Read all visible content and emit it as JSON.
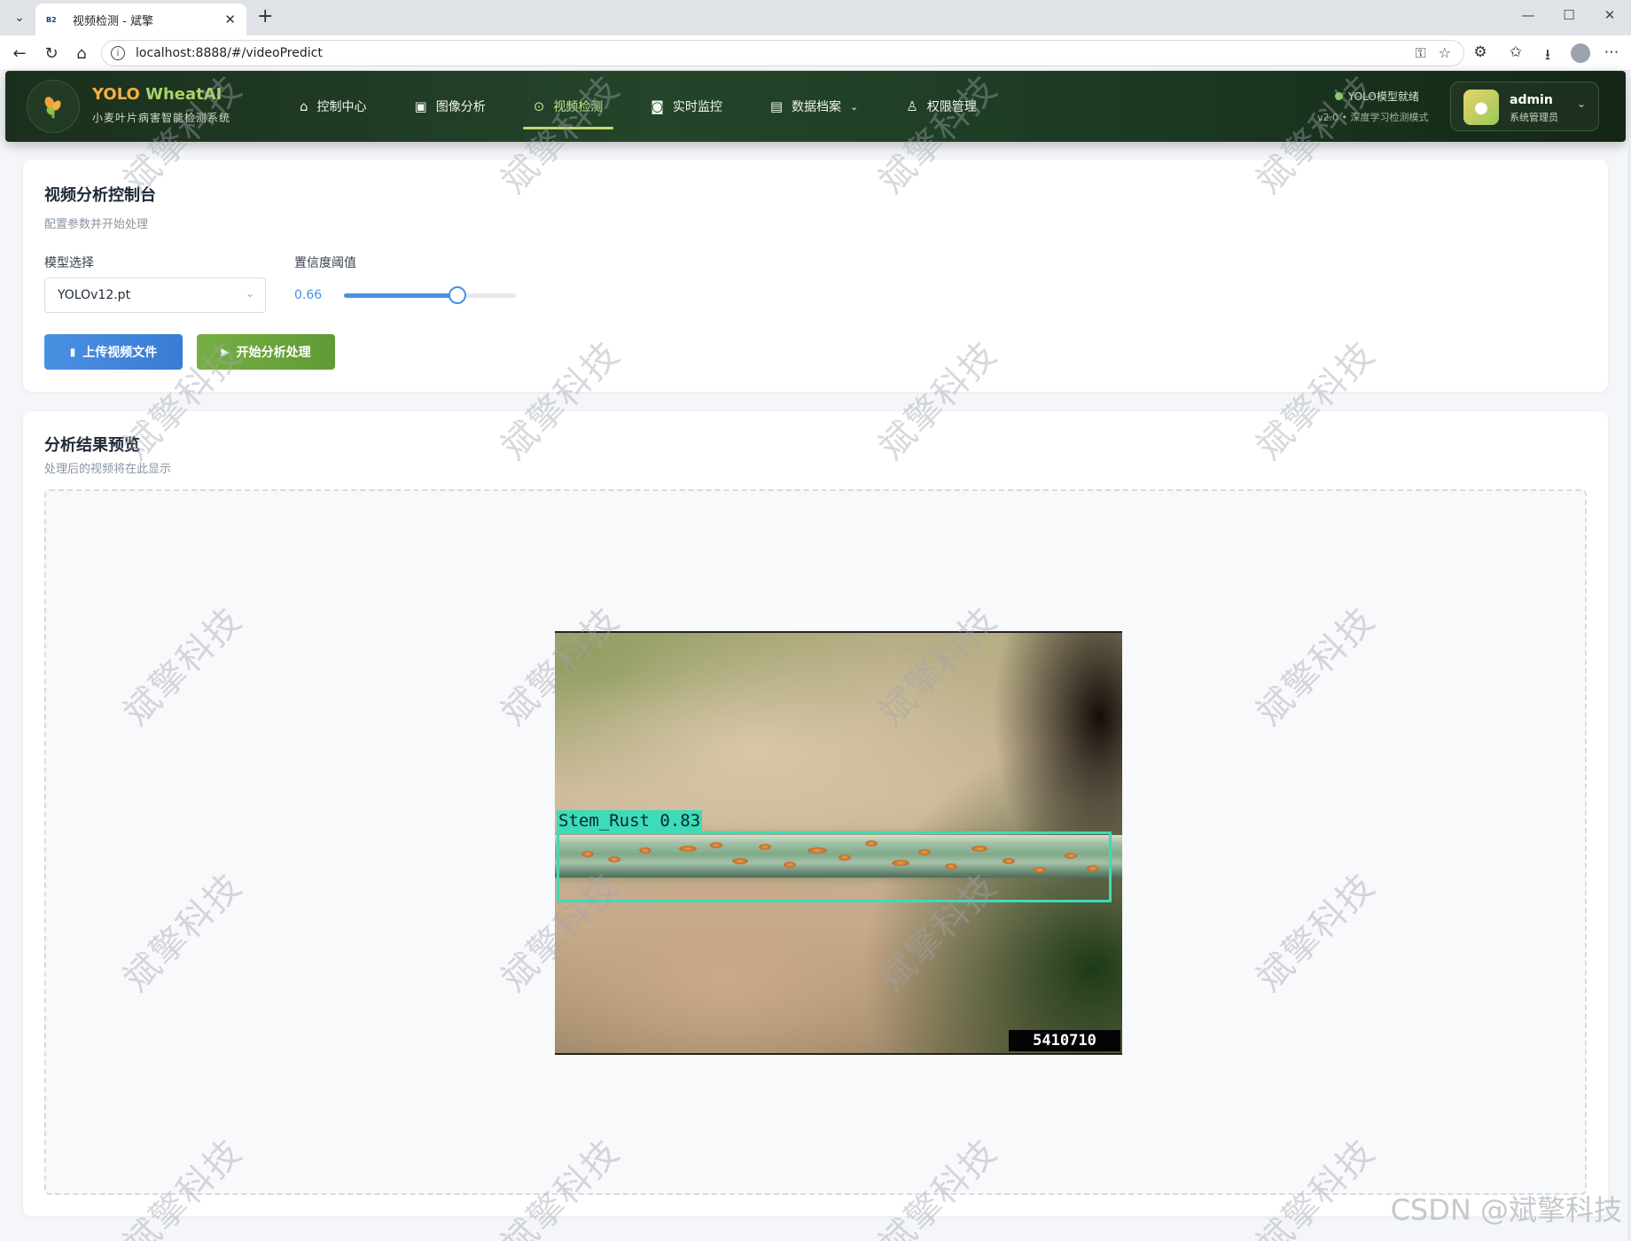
{
  "browser": {
    "tab_title": "视频检测 - 斌擎",
    "tab_favicon": "B2",
    "url": "localhost:8888/#/videoPredict"
  },
  "header": {
    "brand_part1": "YOLO",
    "brand_part2": "WheatAI",
    "subtitle": "小麦叶片病害智能检测系统",
    "nav": [
      {
        "label": "控制中心",
        "icon": "home-icon"
      },
      {
        "label": "图像分析",
        "icon": "image-icon"
      },
      {
        "label": "视频检测",
        "icon": "play-circle-icon",
        "active": true
      },
      {
        "label": "实时监控",
        "icon": "camera-icon"
      },
      {
        "label": "数据档案",
        "icon": "document-icon",
        "dropdown": true
      },
      {
        "label": "权限管理",
        "icon": "user-icon"
      }
    ],
    "status_title": "YOLO模型就绪",
    "status_detail": "v2.0 • 深度学习检测模式",
    "user": {
      "name": "admin",
      "role": "系统管理员"
    }
  },
  "control_panel": {
    "title": "视频分析控制台",
    "subtitle": "配置参数并开始处理",
    "model_label": "模型选择",
    "model_value": "YOLOv12.pt",
    "confidence_label": "置信度阈值",
    "confidence_value": "0.66",
    "confidence_fraction": 0.66,
    "upload_button": "上传视频文件",
    "start_button": "开始分析处理"
  },
  "preview_panel": {
    "title": "分析结果预览",
    "subtitle": "处理后的视频将在此显示",
    "detection_label": "Stem_Rust  0.83",
    "frame_id": "5410710"
  },
  "watermark": {
    "text": "斌擎科技",
    "footer": "CSDN @斌擎科技"
  },
  "colors": {
    "accent_blue": "#4a90e2",
    "accent_green": "#76b043",
    "header_green": "#24452a",
    "detection_box": "#3ddbb8"
  }
}
